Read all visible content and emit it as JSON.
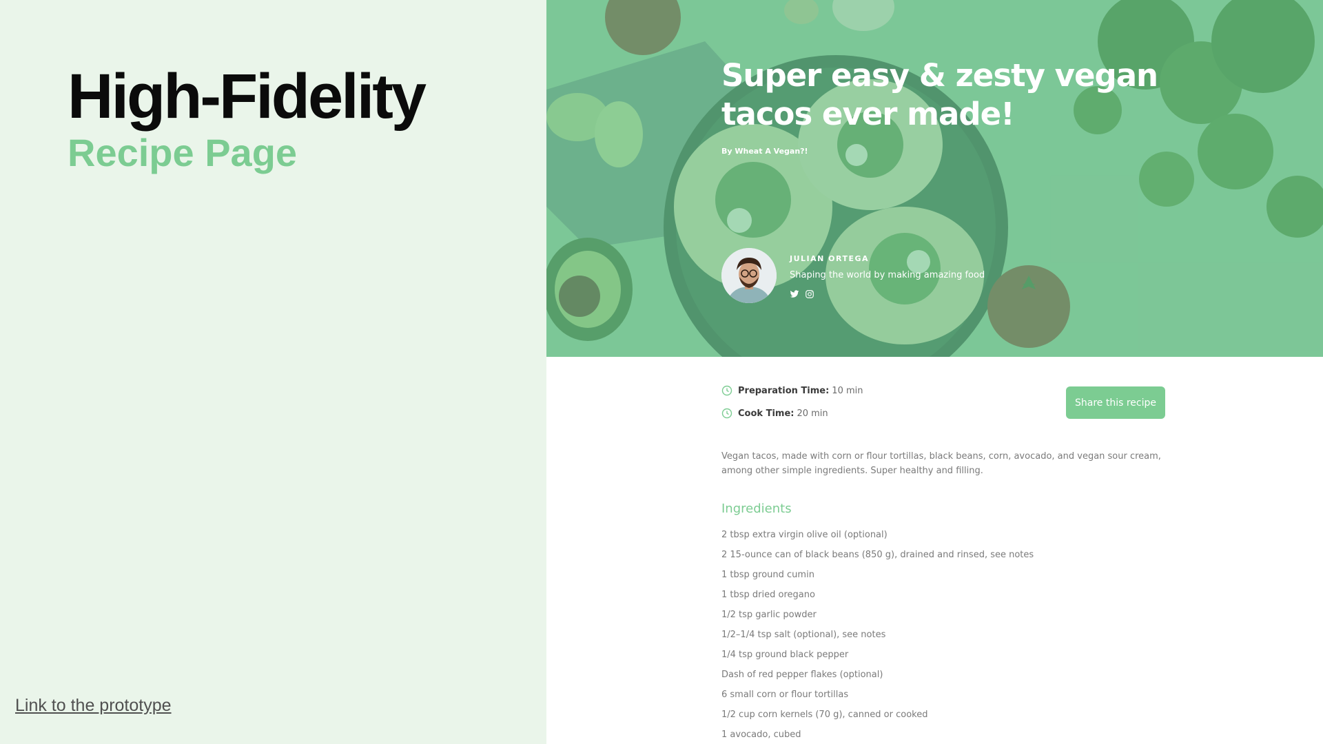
{
  "left": {
    "title": "High-Fidelity",
    "subtitle": "Recipe Page",
    "link": "Link to the prototype"
  },
  "recipe": {
    "title": "Super easy & zesty vegan tacos ever made!",
    "byline": "By Wheat A Vegan?!",
    "author": {
      "name": "JULIAN ORTEGA",
      "bio": "Shaping the world by making amazing food",
      "socials": [
        "twitter-icon",
        "instagram-icon"
      ]
    },
    "prep": {
      "label": "Preparation Time:",
      "value": "10 min"
    },
    "cook": {
      "label": "Cook Time:",
      "value": "20 min"
    },
    "share_label": "Share this recipe",
    "description": "Vegan tacos, made with corn or flour tortillas, black beans, corn, avocado, and vegan sour cream, among other simple ingredients. Super healthy and filling.",
    "ingredients_title": "Ingredients",
    "ingredients": [
      "2 tbsp extra virgin olive oil (optional)",
      "2 15-ounce can of black beans (850 g), drained and rinsed, see notes",
      "1 tbsp ground cumin",
      "1 tbsp dried oregano",
      "1/2 tsp garlic powder",
      "1/2–1/4 tsp salt (optional), see notes",
      "1/4 tsp ground black pepper",
      "Dash of red pepper flakes (optional)",
      "6 small corn or flour tortillas",
      "1/2 cup corn kernels (70 g), canned or cooked",
      "1 avocado, cubed"
    ]
  },
  "colors": {
    "accent": "#7ccc92",
    "left_bg": "#eaf5ea",
    "hero_overlay": "#6ec48e"
  }
}
